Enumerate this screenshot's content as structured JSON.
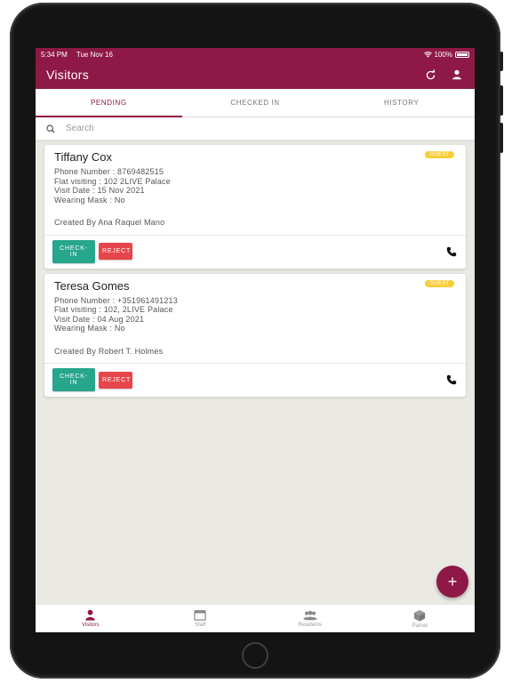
{
  "statusbar": {
    "time": "5:34 PM",
    "date": "Tue Nov 16",
    "battery": "100%"
  },
  "header": {
    "title": "Visitors",
    "refresh_icon": "refresh-icon",
    "profile_icon": "user-icon"
  },
  "tabs": [
    {
      "label": "PENDING",
      "active": true
    },
    {
      "label": "CHECKED IN",
      "active": false
    },
    {
      "label": "HISTORY",
      "active": false
    }
  ],
  "search": {
    "placeholder": "Search"
  },
  "visitors": [
    {
      "name": "Tiffany Cox",
      "badge": "GUEST",
      "phone": "Phone Number : 8769482515",
      "flat": "Flat visiting : 102 2LIVE Palace",
      "visit_date": "Visit Date : 15 Nov 2021",
      "mask": "Wearing Mask : No",
      "created_by": "Created By Ana Raquel Mano",
      "checkin_label": "CHECK-IN",
      "reject_label": "REJECT"
    },
    {
      "name": "Teresa Gomes",
      "badge": "GUEST",
      "phone": "Phone Number : +351961491213",
      "flat": "Flat visiting : 102, 2LIVE Palace",
      "visit_date": "Visit Date : 04 Aug 2021",
      "mask": "Wearing Mask : No",
      "created_by": "Created By Robert T. Holmes",
      "checkin_label": "CHECK-IN",
      "reject_label": "REJECT"
    }
  ],
  "fab": {
    "label": "+"
  },
  "bottomnav": [
    {
      "label": "Visitors",
      "icon": "visitor-icon",
      "active": true
    },
    {
      "label": "Staff",
      "icon": "calendar-icon",
      "active": false
    },
    {
      "label": "Residents",
      "icon": "residents-icon",
      "active": false
    },
    {
      "label": "Parcel",
      "icon": "parcel-icon",
      "active": false
    }
  ],
  "colors": {
    "brand": "#8e1846",
    "checkin": "#26a68a",
    "reject": "#e6464b",
    "badge": "#f8cd3a"
  }
}
